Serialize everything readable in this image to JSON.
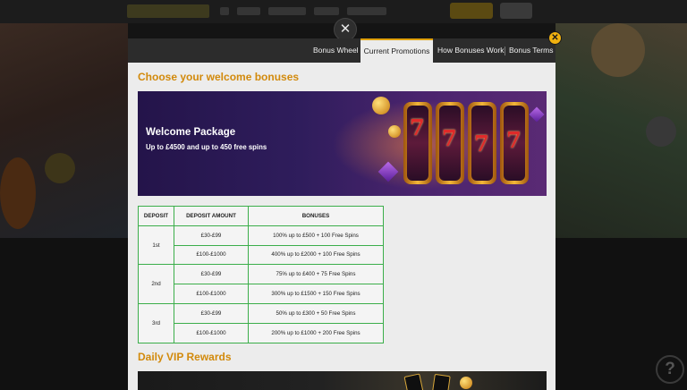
{
  "tabs": {
    "bonus_wheel": "Bonus Wheel",
    "current_promotions": "Current Promotions",
    "how_bonuses_work": "How Bonuses Work",
    "bonus_terms": "Bonus Terms"
  },
  "sections": {
    "welcome_title": "Choose your welcome bonuses",
    "vip_title": "Daily VIP Rewards"
  },
  "banner": {
    "title": "Welcome Package",
    "subtitle": "Up to £4500 and up to 450 free spins"
  },
  "table": {
    "headers": [
      "DEPOSIT",
      "DEPOSIT AMOUNT",
      "BONUSES"
    ],
    "groups": [
      {
        "deposit": "1st",
        "rows": [
          {
            "amount": "£30-£99",
            "bonus": "100% up to £500 + 100 Free Spins"
          },
          {
            "amount": "£100-£1000",
            "bonus": "400% up to £2000 + 100 Free Spins"
          }
        ]
      },
      {
        "deposit": "2nd",
        "rows": [
          {
            "amount": "£30-£99",
            "bonus": "75% up to £400 + 75 Free Spins"
          },
          {
            "amount": "£100-£1000",
            "bonus": "300% up to £1500 + 150 Free Spins"
          }
        ]
      },
      {
        "deposit": "3rd",
        "rows": [
          {
            "amount": "£30-£99",
            "bonus": "50% up to £300 + 50 Free Spins"
          },
          {
            "amount": "£100-£1000",
            "bonus": "200% up to £1000 + 200 Free Spins"
          }
        ]
      }
    ]
  },
  "icons": {
    "close_overlay": "close-icon",
    "close_modal": "close-icon",
    "help": "help-icon",
    "help_glyph": "?",
    "close_glyph": "✕"
  },
  "colors": {
    "accent": "#e0a10c",
    "section_title": "#d28a0c",
    "table_border": "#3bae4a"
  }
}
